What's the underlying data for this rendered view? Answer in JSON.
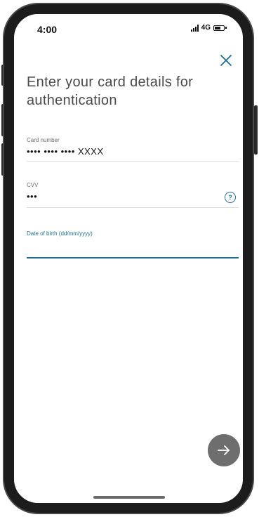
{
  "status_bar": {
    "time": "4:00",
    "network": "4G",
    "icons": [
      "signal-icon",
      "battery-icon"
    ]
  },
  "header": {
    "close_icon": "close-icon",
    "title": "Enter your card details for authentication"
  },
  "form": {
    "card_number": {
      "label": "Card number",
      "value": "•••• •••• •••• XXXX"
    },
    "cvv": {
      "label": "CVV",
      "value": "•••",
      "help_icon": "help-icon",
      "help_glyph": "?"
    },
    "dob": {
      "label": "Date of birth (dd/mm/yyyy)",
      "value": ""
    }
  },
  "actions": {
    "next_icon": "arrow-right-icon"
  },
  "colors": {
    "accent": "#1c6e8c",
    "button_bg": "#6e6e6e",
    "title_text": "#4a4a4a",
    "frame": "#1c1c1c"
  }
}
